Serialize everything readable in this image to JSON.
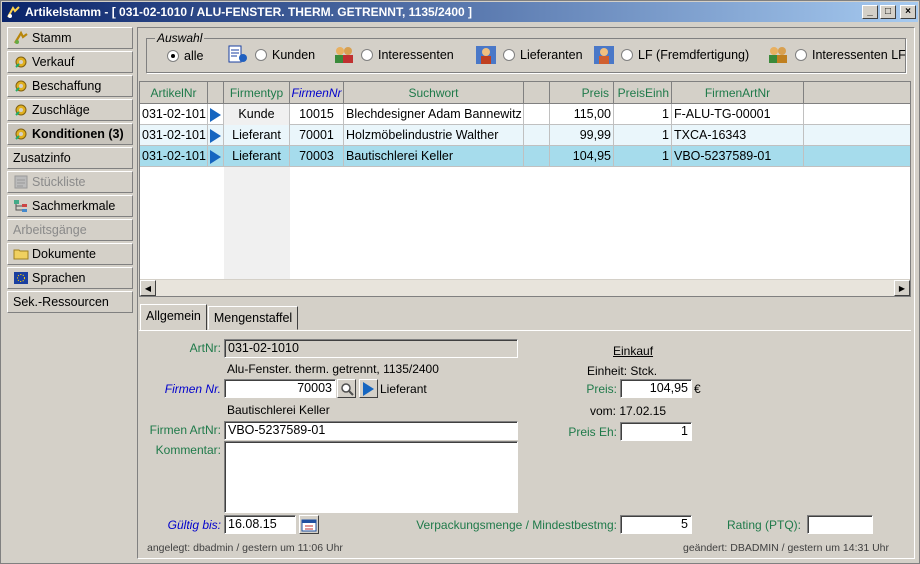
{
  "window": {
    "title": "Artikelstamm - [ 031-02-1010 / ALU-FENSTER. THERM. GETRENNT, 1135/2400 ]",
    "minimize": "_",
    "maximize": "□",
    "close": "×"
  },
  "sidebar": {
    "items": [
      {
        "label": "Stamm",
        "icon": "handshake-icon"
      },
      {
        "label": "Verkauf",
        "icon": "gear-icon"
      },
      {
        "label": "Beschaffung",
        "icon": "gear-icon"
      },
      {
        "label": "Zuschläge",
        "icon": "gear-icon"
      },
      {
        "label": "Konditionen (3)",
        "icon": "gear-icon"
      },
      {
        "label": "Zusatzinfo",
        "icon": ""
      },
      {
        "label": "Stückliste",
        "icon": "list-icon"
      },
      {
        "label": "Sachmerkmale",
        "icon": "tree-icon"
      },
      {
        "label": "Arbeitsgänge",
        "icon": ""
      },
      {
        "label": "Dokumente",
        "icon": "folder-icon"
      },
      {
        "label": "Sprachen",
        "icon": "eu-flag-icon"
      },
      {
        "label": "Sek.-Ressourcen",
        "icon": ""
      }
    ]
  },
  "auswahl": {
    "legend": "Auswahl",
    "options": [
      {
        "label": "alle",
        "selected": true
      },
      {
        "label": "Kunden",
        "selected": false
      },
      {
        "label": "Interessenten",
        "selected": false
      },
      {
        "label": "Lieferanten",
        "selected": false
      },
      {
        "label": "LF (Fremdfertigung)",
        "selected": false
      },
      {
        "label": "Interessenten LF",
        "selected": false
      }
    ]
  },
  "grid": {
    "columns": [
      "ArtikelNr",
      "Firmentyp",
      "FirmenNr",
      "Suchwort",
      "Preis",
      "PreisEinh",
      "FirmenArtNr"
    ],
    "rows": [
      {
        "artikelnr": "031-02-101",
        "firmentyp": "Kunde",
        "firmennr": "10015",
        "suchwort": "Blechdesigner Adam Bannewitz",
        "preis": "115,00",
        "preiseinh": "1",
        "firmenartnr": "F-ALU-TG-00001"
      },
      {
        "artikelnr": "031-02-101",
        "firmentyp": "Lieferant",
        "firmennr": "70001",
        "suchwort": "Holzmöbelindustrie Walther",
        "preis": "99,99",
        "preiseinh": "1",
        "firmenartnr": "TXCA-16343"
      },
      {
        "artikelnr": "031-02-101",
        "firmentyp": "Lieferant",
        "firmennr": "70003",
        "suchwort": "Bautischlerei Keller",
        "preis": "104,95",
        "preiseinh": "1",
        "firmenartnr": "VBO-5237589-01"
      }
    ]
  },
  "tabs": [
    "Allgemein",
    "Mengenstaffel"
  ],
  "form": {
    "artnr_label": "ArtNr:",
    "artnr_value": "031-02-1010",
    "artikel_bezeichnung": "Alu-Fenster. therm. getrennt, 1135/2400",
    "firmennr_label": "Firmen Nr.",
    "firmennr_value": "70003",
    "firmentyp": "Lieferant",
    "firmenname": "Bautischlerei Keller",
    "firmenartnr_label": "Firmen ArtNr:",
    "firmenartnr_value": "VBO-5237589-01",
    "kommentar_label": "Kommentar:",
    "kommentar_value": "",
    "gueltig_label": "Gültig bis:",
    "gueltig_value": "16.08.15",
    "einkauf_title": "Einkauf",
    "einheit": "Einheit: Stck.",
    "preis_label": "Preis:",
    "preis_value": "104,95",
    "currency": "€",
    "vom": "vom: 17.02.15",
    "preiseh_label": "Preis Eh:",
    "preiseh_value": "1",
    "verpackung_label": "Verpackungsmenge / Mindestbestmg:",
    "verpackung_value": "5",
    "rating_label": "Rating (PTQ):",
    "rating_value": "",
    "angelegt": "angelegt: dbadmin / gestern um 11:06 Uhr",
    "geaendert": "geändert: DBADMIN / gestern um 14:31 Uhr"
  }
}
